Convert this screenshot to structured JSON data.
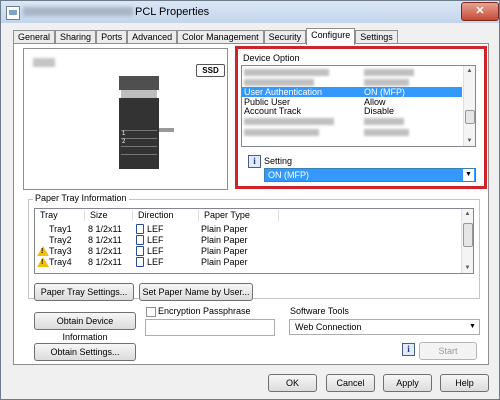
{
  "window": {
    "title": "PCL Properties",
    "close_label": "✕"
  },
  "tabs": [
    "General",
    "Sharing",
    "Ports",
    "Advanced",
    "Color Management",
    "Security",
    "Configure",
    "Settings"
  ],
  "active_tab": "Configure",
  "preview": {
    "ssd_badge": "SSD",
    "tray_numbers": [
      "1",
      "2"
    ]
  },
  "device_option": {
    "title": "Device Option",
    "items": [
      {
        "name": "",
        "value": "",
        "blurred": true
      },
      {
        "name": "",
        "value": "",
        "blurred": true
      },
      {
        "name": "User Authentication",
        "value": "ON (MFP)",
        "selected": true
      },
      {
        "name": "Public User",
        "value": "Allow"
      },
      {
        "name": "Account Track",
        "value": "Disable"
      },
      {
        "name": "",
        "value": "",
        "blurred": true
      },
      {
        "name": "",
        "value": "",
        "blurred": true
      }
    ],
    "setting_label": "Setting",
    "setting_value": "ON (MFP)",
    "selected_color": "#3399ff"
  },
  "paper_tray": {
    "title": "Paper Tray Information",
    "columns": [
      "Tray",
      "Size",
      "Direction",
      "Paper Type"
    ],
    "rows": [
      {
        "tray": "Tray1",
        "size": "8 1/2x11",
        "direction": "LEF",
        "type": "Plain Paper",
        "warning": false
      },
      {
        "tray": "Tray2",
        "size": "8 1/2x11",
        "direction": "LEF",
        "type": "Plain Paper",
        "warning": false
      },
      {
        "tray": "Tray3",
        "size": "8 1/2x11",
        "direction": "LEF",
        "type": "Plain Paper",
        "warning": true
      },
      {
        "tray": "Tray4",
        "size": "8 1/2x11",
        "direction": "LEF",
        "type": "Plain Paper",
        "warning": true
      }
    ],
    "settings_button": "Paper Tray Settings...",
    "set_name_button": "Set Paper Name by User..."
  },
  "obtain_device_button": "Obtain Device Information",
  "obtain_settings_button": "Obtain Settings...",
  "encryption": {
    "label": "Encryption Passphrase",
    "value": ""
  },
  "software_tools": {
    "label": "Software Tools",
    "value": "Web Connection",
    "start_button": "Start"
  },
  "footer": {
    "ok": "OK",
    "cancel": "Cancel",
    "apply": "Apply",
    "help": "Help"
  }
}
